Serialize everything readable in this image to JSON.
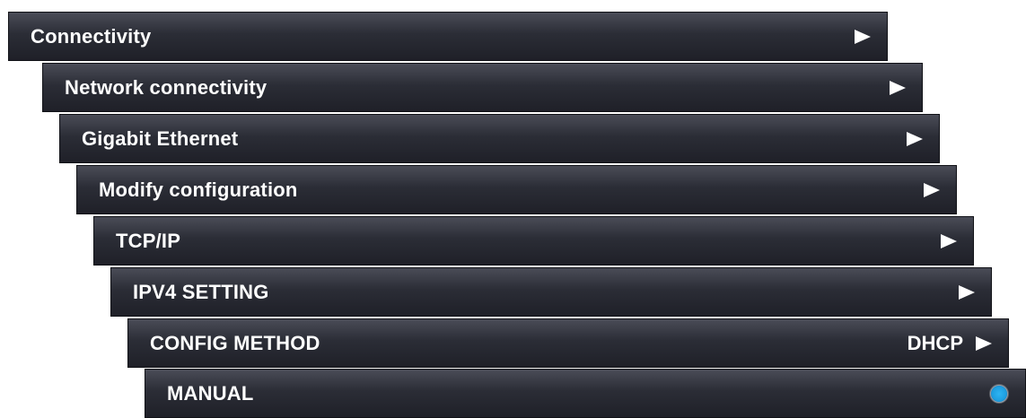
{
  "menu": {
    "items": [
      {
        "label": "Connectivity"
      },
      {
        "label": "Network connectivity"
      },
      {
        "label": "Gigabit Ethernet"
      },
      {
        "label": "Modify configuration"
      },
      {
        "label": "TCP/IP"
      },
      {
        "label": "IPV4 SETTING"
      },
      {
        "label": "CONFIG METHOD",
        "value": "DHCP"
      },
      {
        "label": "MANUAL",
        "selected": false
      }
    ],
    "icons": {
      "submenu": "chevron-right-icon",
      "option": "radio-button-icon"
    },
    "colors": {
      "background": "#ffffff",
      "item_gradient_top": "#4a4c57",
      "item_gradient_bottom": "#1f2028",
      "text": "#ffffff",
      "radio_accent": "#2fb4f2"
    }
  }
}
